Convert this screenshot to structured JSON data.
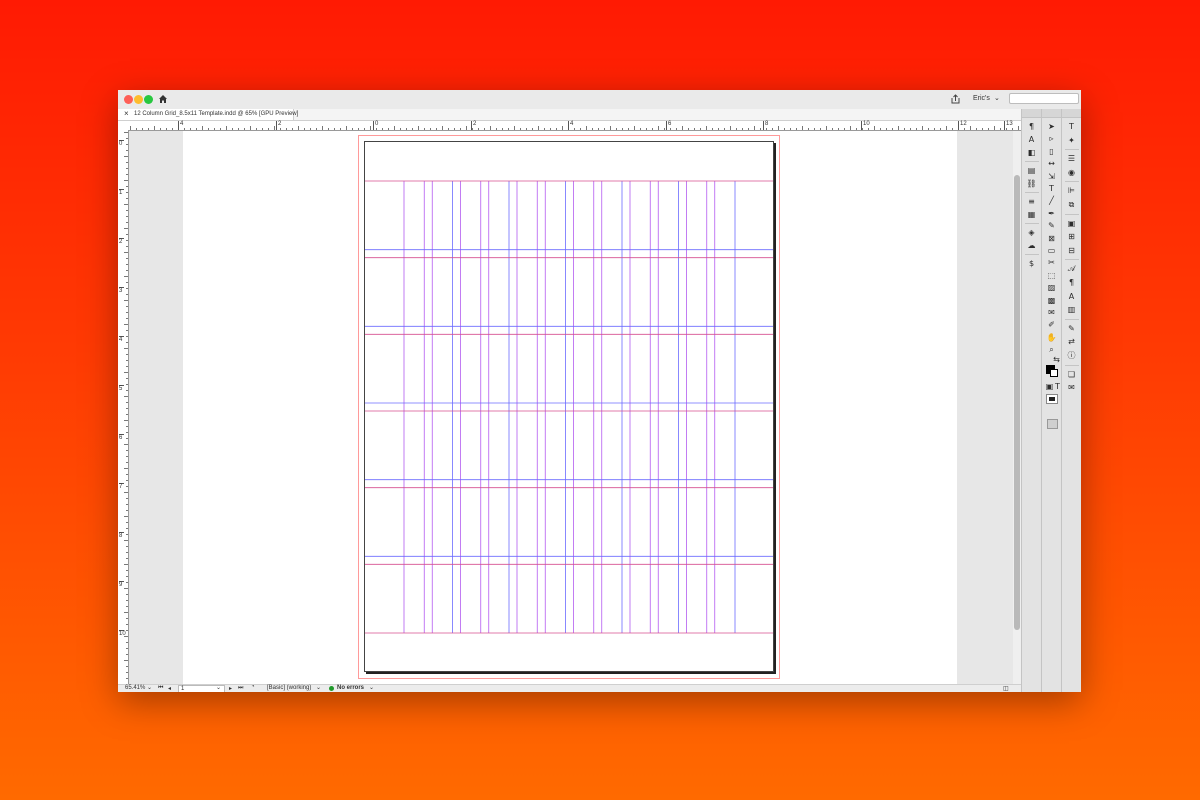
{
  "window": {
    "user_menu": "Eric's",
    "search_placeholder": "",
    "document_tab": "12 Column Grid_8.5x11 Template.indd @ 65% [GPU Preview]",
    "tab_close": "×"
  },
  "rulers": {
    "horizontal": [
      "4",
      "2",
      "0",
      "2",
      "4",
      "6",
      "8",
      "10",
      "12",
      "13"
    ],
    "vertical": [
      "0",
      "1",
      "2",
      "3",
      "4",
      "5",
      "6",
      "7",
      "8",
      "9",
      "10"
    ]
  },
  "status": {
    "zoom": "65.41%",
    "page": "1",
    "style": "[Basic] (working)",
    "preflight": "No errors",
    "colors": {
      "ok": "#1f9a2a"
    }
  },
  "grid": {
    "columns": 12,
    "rows": 6,
    "colors": {
      "column_guide": "#b35bf0",
      "gutter_guide": "#6b6bff",
      "row_guide": "#d64f8f",
      "bleed": "#ff8a8a"
    }
  },
  "panel_icons": {
    "a": [
      "paragraph-styles-icon",
      "character-styles-icon",
      "object-styles-icon",
      "pages-icon",
      "links-icon",
      "stroke-icon",
      "swatches-icon",
      "layers-icon",
      "cc-libraries-icon",
      "price-icon"
    ],
    "b": [
      "selection-tool-icon",
      "direct-selection-icon",
      "page-tool-icon",
      "gap-tool-icon",
      "content-collector-icon",
      "type-tool-icon",
      "line-tool-icon",
      "pen-tool-icon",
      "pencil-tool-icon",
      "rectangle-frame-icon",
      "rectangle-tool-icon",
      "scissors-tool-icon",
      "free-transform-icon",
      "gradient-swatch-icon",
      "gradient-feather-icon",
      "note-tool-icon",
      "eyedropper-icon",
      "hand-tool-icon",
      "zoom-tool-icon"
    ],
    "c": [
      "type-panel-icon",
      "effects-icon",
      "lines-icon",
      "color-icon",
      "align-icon",
      "pathfinder-icon",
      "text-wrap-icon",
      "table-icon",
      "cell-styles-icon",
      "glyphs-icon",
      "paragraph-icon",
      "character-icon",
      "story-icon",
      "notes-icon",
      "tracking-icon",
      "info-icon",
      "scripts-icon",
      "comments-icon"
    ]
  },
  "glyphs": {
    "paragraph-styles-icon": "¶",
    "character-styles-icon": "A",
    "object-styles-icon": "◧",
    "pages-icon": "▤",
    "links-icon": "⛓",
    "stroke-icon": "≡",
    "swatches-icon": "▦",
    "layers-icon": "◈",
    "cc-libraries-icon": "☁",
    "price-icon": "$",
    "selection-tool-icon": "➤",
    "direct-selection-icon": "▹",
    "page-tool-icon": "▯",
    "gap-tool-icon": "↔",
    "content-collector-icon": "⇲",
    "type-tool-icon": "T",
    "line-tool-icon": "╱",
    "pen-tool-icon": "✒",
    "pencil-tool-icon": "✎",
    "rectangle-frame-icon": "⊠",
    "rectangle-tool-icon": "▭",
    "scissors-tool-icon": "✂",
    "free-transform-icon": "⬚",
    "gradient-swatch-icon": "▨",
    "gradient-feather-icon": "▩",
    "note-tool-icon": "✉",
    "eyedropper-icon": "✐",
    "hand-tool-icon": "✋",
    "zoom-tool-icon": "⌕",
    "type-panel-icon": "T",
    "effects-icon": "✦",
    "lines-icon": "☰",
    "color-icon": "◉",
    "align-icon": "⊫",
    "pathfinder-icon": "⧉",
    "text-wrap-icon": "▣",
    "table-icon": "⊞",
    "cell-styles-icon": "⊟",
    "glyphs-icon": "𝒜",
    "paragraph-icon": "¶",
    "character-icon": "A",
    "story-icon": "▥",
    "notes-icon": "✎",
    "tracking-icon": "⇄",
    "info-icon": "ⓘ",
    "scripts-icon": "❏",
    "comments-icon": "✉"
  }
}
